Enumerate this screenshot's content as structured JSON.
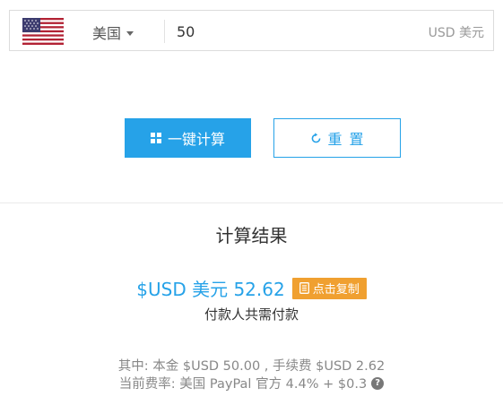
{
  "converter": {
    "flag_icon": "us-flag-icon",
    "country": "美国",
    "amount_value": "50",
    "unit": "USD 美元"
  },
  "actions": {
    "calculate_label": "一键计算",
    "reset_label": "重置"
  },
  "result": {
    "title": "计算结果",
    "total_text": "$USD 美元 52.62",
    "copy_label": "点击复制",
    "payer_note": "付款人共需付款",
    "breakdown": "其中:  本金 $USD 50.00 ,  手续费 $USD 2.62",
    "rate": "当前费率:  美国 PayPal 官方 4.4% + $0.3"
  },
  "colors": {
    "accent": "#26a2e8",
    "copy_button": "#f0a030",
    "muted_text": "#888888"
  }
}
